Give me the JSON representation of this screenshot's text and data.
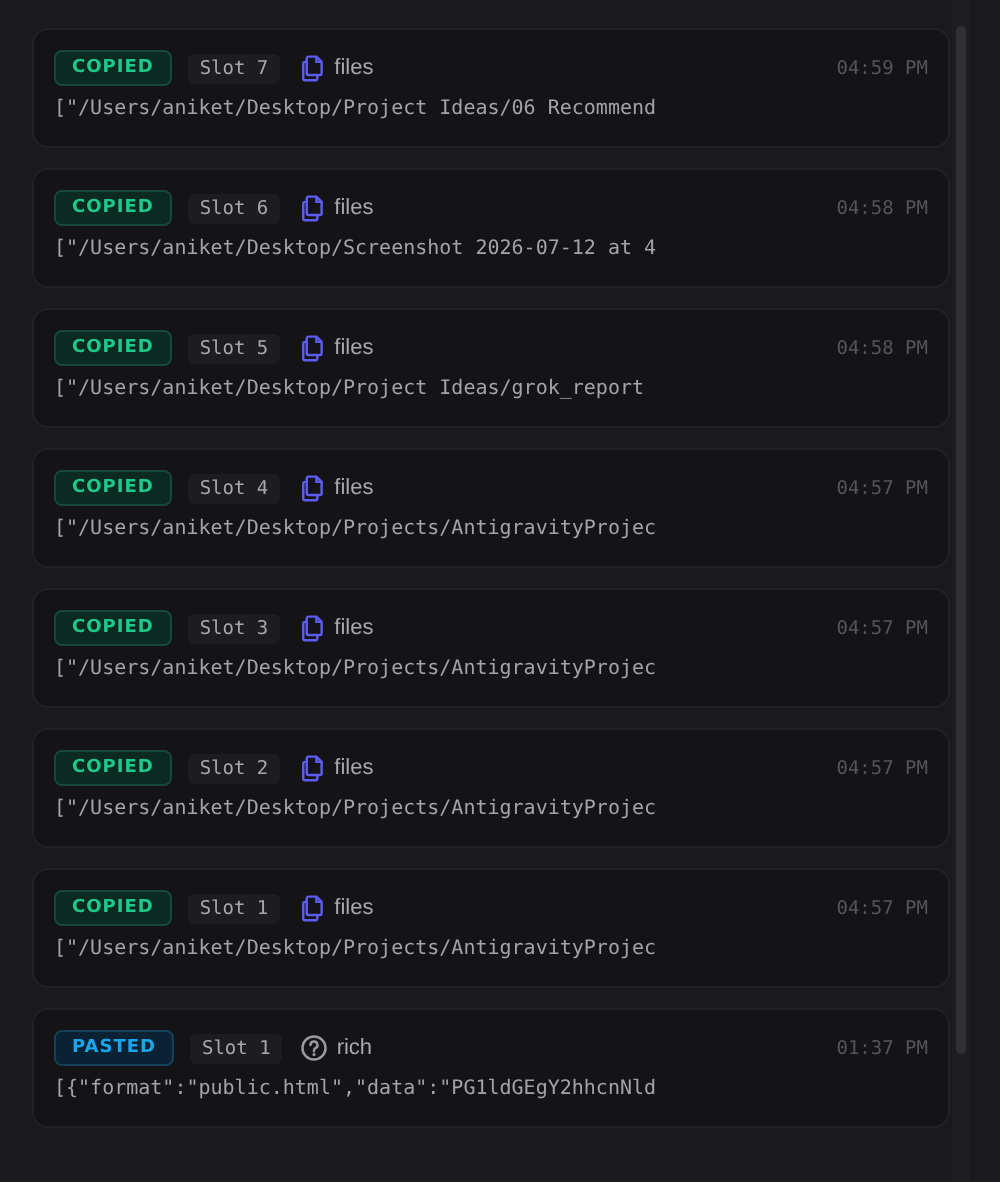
{
  "entries": [
    {
      "status": {
        "label": "COPIED",
        "kind": "copied"
      },
      "slot": "Slot 7",
      "type": {
        "label": "files",
        "kind": "files"
      },
      "time": "04:59 PM",
      "content": "[\"/Users/aniket/Desktop/Project Ideas/06 Recommend"
    },
    {
      "status": {
        "label": "COPIED",
        "kind": "copied"
      },
      "slot": "Slot 6",
      "type": {
        "label": "files",
        "kind": "files"
      },
      "time": "04:58 PM",
      "content": "[\"/Users/aniket/Desktop/Screenshot 2026-07-12 at 4"
    },
    {
      "status": {
        "label": "COPIED",
        "kind": "copied"
      },
      "slot": "Slot 5",
      "type": {
        "label": "files",
        "kind": "files"
      },
      "time": "04:58 PM",
      "content": "[\"/Users/aniket/Desktop/Project Ideas/grok_report"
    },
    {
      "status": {
        "label": "COPIED",
        "kind": "copied"
      },
      "slot": "Slot 4",
      "type": {
        "label": "files",
        "kind": "files"
      },
      "time": "04:57 PM",
      "content": "[\"/Users/aniket/Desktop/Projects/AntigravityProjec"
    },
    {
      "status": {
        "label": "COPIED",
        "kind": "copied"
      },
      "slot": "Slot 3",
      "type": {
        "label": "files",
        "kind": "files"
      },
      "time": "04:57 PM",
      "content": "[\"/Users/aniket/Desktop/Projects/AntigravityProjec"
    },
    {
      "status": {
        "label": "COPIED",
        "kind": "copied"
      },
      "slot": "Slot 2",
      "type": {
        "label": "files",
        "kind": "files"
      },
      "time": "04:57 PM",
      "content": "[\"/Users/aniket/Desktop/Projects/AntigravityProjec"
    },
    {
      "status": {
        "label": "COPIED",
        "kind": "copied"
      },
      "slot": "Slot 1",
      "type": {
        "label": "files",
        "kind": "files"
      },
      "time": "04:57 PM",
      "content": "[\"/Users/aniket/Desktop/Projects/AntigravityProjec"
    },
    {
      "status": {
        "label": "PASTED",
        "kind": "pasted"
      },
      "slot": "Slot 1",
      "type": {
        "label": "rich",
        "kind": "unknown"
      },
      "time": "01:37 PM",
      "content": "[{\"format\":\"public.html\",\"data\":\"PG1ldGEgY2hhcnNld"
    }
  ]
}
